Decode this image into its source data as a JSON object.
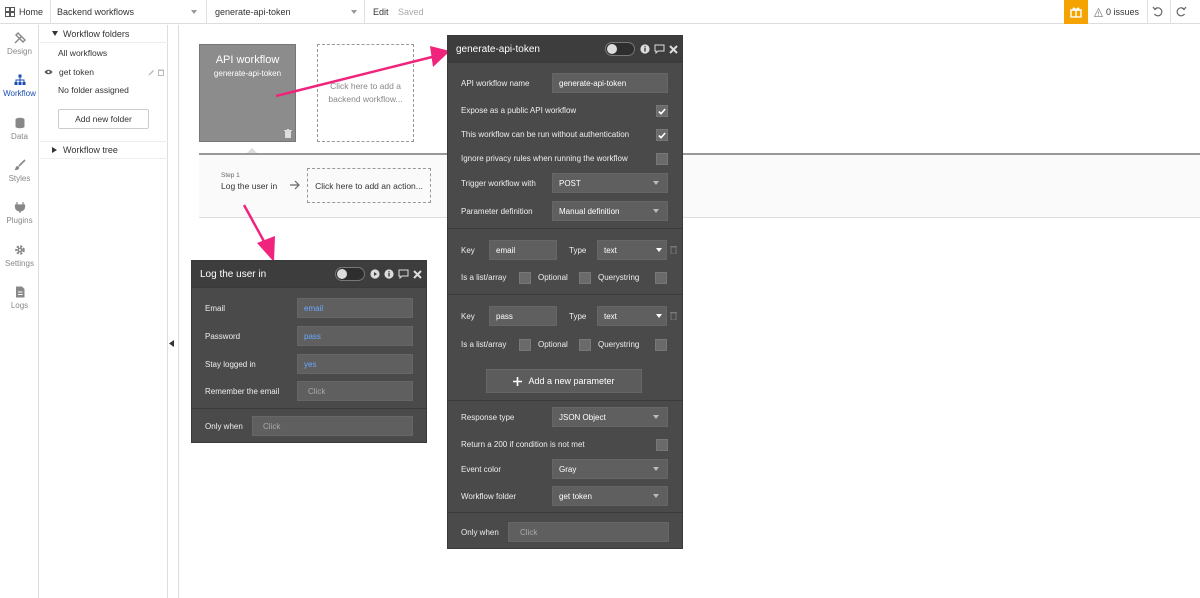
{
  "topbar": {
    "home_label": "Home",
    "page_select": "Backend workflows",
    "workflow_select": "generate-api-token",
    "edit_label": "Edit",
    "saved_label": "Saved",
    "issues_label": "0 issues"
  },
  "rail": {
    "items": [
      {
        "label": "Design",
        "icon": "design-icon"
      },
      {
        "label": "Workflow",
        "icon": "workflow-icon"
      },
      {
        "label": "Data",
        "icon": "data-icon"
      },
      {
        "label": "Styles",
        "icon": "styles-icon"
      },
      {
        "label": "Plugins",
        "icon": "plugins-icon"
      },
      {
        "label": "Settings",
        "icon": "settings-icon"
      },
      {
        "label": "Logs",
        "icon": "logs-icon"
      }
    ]
  },
  "folders": {
    "header": "Workflow folders",
    "all": "All workflows",
    "item": "get token",
    "none": "No folder assigned",
    "add_button": "Add new folder",
    "tree": "Workflow tree"
  },
  "canvas": {
    "api_card_title": "API workflow",
    "api_card_name": "generate-api-token",
    "add_backend": "Click here to add a backend workflow...",
    "step_label": "Step 1",
    "step_name": "Log the user in",
    "add_action": "Click here to add an action..."
  },
  "login_panel": {
    "title": "Log the user in",
    "rows": [
      {
        "label": "Email",
        "value": "email"
      },
      {
        "label": "Password",
        "value": "pass"
      },
      {
        "label": "Stay logged in",
        "value": "yes"
      },
      {
        "label": "Remember the email",
        "value": "Click"
      }
    ],
    "only_when": "Only when",
    "only_when_value": "Click"
  },
  "api_panel": {
    "title": "generate-api-token",
    "name_label": "API workflow name",
    "name_value": "generate-api-token",
    "expose_label": "Expose as a public API workflow",
    "noauth_label": "This workflow can be run without authentication",
    "privacy_label": "Ignore privacy rules when running the workflow",
    "trigger_label": "Trigger workflow with",
    "trigger_value": "POST",
    "param_def_label": "Parameter definition",
    "param_def_value": "Manual definition",
    "params": [
      {
        "key_label": "Key",
        "key": "email",
        "type_label": "Type",
        "type": "text",
        "list_label": "Is a list/array",
        "optional_label": "Optional",
        "query_label": "Querystring"
      },
      {
        "key_label": "Key",
        "key": "pass",
        "type_label": "Type",
        "type": "text",
        "list_label": "Is a list/array",
        "optional_label": "Optional",
        "query_label": "Querystring"
      }
    ],
    "add_param": "Add a new parameter",
    "response_label": "Response type",
    "response_value": "JSON Object",
    "return200_label": "Return a 200 if condition is not met",
    "color_label": "Event color",
    "color_value": "Gray",
    "folder_label": "Workflow folder",
    "folder_value": "get token",
    "only_when": "Only when",
    "only_when_value": "Click"
  },
  "colors": {
    "accent": "#1a4db3",
    "arrow": "#f0247d",
    "panel": "#4a4a4a",
    "gift": "#f5a300"
  }
}
